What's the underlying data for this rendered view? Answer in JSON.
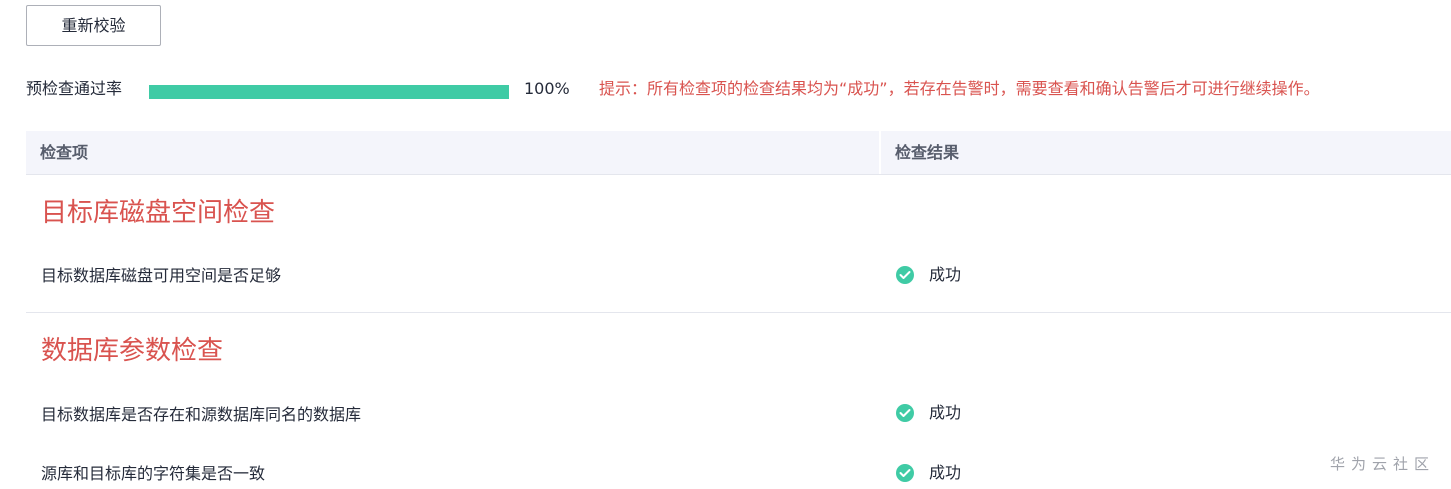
{
  "toolbar": {
    "recheck_label": "重新校验"
  },
  "precheck": {
    "label": "预检查通过率",
    "pass_rate_text": "100%",
    "pass_rate_fraction": 1.0,
    "hint": "提示：所有检查项的检查结果均为“成功”，若存在告警时，需要查看和确认告警后才可进行继续操作。"
  },
  "table": {
    "headers": {
      "item": "检查项",
      "result": "检查结果"
    },
    "groups": [
      {
        "title": "目标库磁盘空间检查",
        "rows": [
          {
            "item": "目标数据库磁盘可用空间是否足够",
            "result": "成功",
            "icon": "check-circle-icon"
          }
        ]
      },
      {
        "title": "数据库参数检查",
        "rows": [
          {
            "item": "目标数据库是否存在和源数据库同名的数据库",
            "result": "成功",
            "icon": "check-circle-icon"
          },
          {
            "item": "源库和目标库的字符集是否一致",
            "result": "成功",
            "icon": "check-circle-icon"
          }
        ]
      }
    ]
  },
  "watermark": "华为云社区",
  "colors": {
    "success": "#3fcba5",
    "warning_text": "#d9534f",
    "header_bg": "#f4f5fb"
  }
}
